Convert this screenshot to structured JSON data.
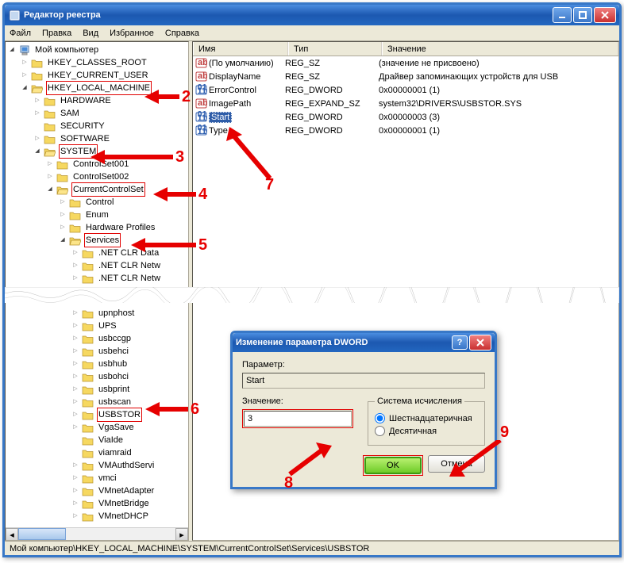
{
  "window": {
    "title": "Редактор реестра"
  },
  "menu": [
    "Файл",
    "Правка",
    "Вид",
    "Избранное",
    "Справка"
  ],
  "tree_top": [
    {
      "depth": 0,
      "exp": "open",
      "icon": "computer",
      "label": "Мой компьютер",
      "red": false
    },
    {
      "depth": 1,
      "exp": "closed",
      "icon": "folder",
      "label": "HKEY_CLASSES_ROOT",
      "red": false
    },
    {
      "depth": 1,
      "exp": "closed",
      "icon": "folder",
      "label": "HKEY_CURRENT_USER",
      "red": false
    },
    {
      "depth": 1,
      "exp": "open",
      "icon": "folder-open",
      "label": "HKEY_LOCAL_MACHINE",
      "red": true
    },
    {
      "depth": 2,
      "exp": "closed",
      "icon": "folder",
      "label": "HARDWARE",
      "red": false
    },
    {
      "depth": 2,
      "exp": "closed",
      "icon": "folder",
      "label": "SAM",
      "red": false
    },
    {
      "depth": 2,
      "exp": "none",
      "icon": "folder",
      "label": "SECURITY",
      "red": false
    },
    {
      "depth": 2,
      "exp": "closed",
      "icon": "folder",
      "label": "SOFTWARE",
      "red": false
    },
    {
      "depth": 2,
      "exp": "open",
      "icon": "folder-open",
      "label": "SYSTEM",
      "red": true
    },
    {
      "depth": 3,
      "exp": "closed",
      "icon": "folder",
      "label": "ControlSet001",
      "red": false
    },
    {
      "depth": 3,
      "exp": "closed",
      "icon": "folder",
      "label": "ControlSet002",
      "red": false
    },
    {
      "depth": 3,
      "exp": "open",
      "icon": "folder-open",
      "label": "CurrentControlSet",
      "red": true
    },
    {
      "depth": 4,
      "exp": "closed",
      "icon": "folder",
      "label": "Control",
      "red": false
    },
    {
      "depth": 4,
      "exp": "closed",
      "icon": "folder",
      "label": "Enum",
      "red": false
    },
    {
      "depth": 4,
      "exp": "closed",
      "icon": "folder",
      "label": "Hardware Profiles",
      "red": false
    },
    {
      "depth": 4,
      "exp": "open",
      "icon": "folder-open",
      "label": "Services",
      "red": true
    },
    {
      "depth": 5,
      "exp": "closed",
      "icon": "folder",
      "label": ".NET CLR Data",
      "red": false
    },
    {
      "depth": 5,
      "exp": "closed",
      "icon": "folder",
      "label": ".NET CLR Netw",
      "red": false
    },
    {
      "depth": 5,
      "exp": "closed",
      "icon": "folder",
      "label": ".NET CLR Netw",
      "red": false
    }
  ],
  "tree_bottom": [
    {
      "depth": 5,
      "exp": "closed",
      "icon": "folder",
      "label": "upnphost",
      "red": false
    },
    {
      "depth": 5,
      "exp": "closed",
      "icon": "folder",
      "label": "UPS",
      "red": false
    },
    {
      "depth": 5,
      "exp": "closed",
      "icon": "folder",
      "label": "usbccgp",
      "red": false
    },
    {
      "depth": 5,
      "exp": "closed",
      "icon": "folder",
      "label": "usbehci",
      "red": false
    },
    {
      "depth": 5,
      "exp": "closed",
      "icon": "folder",
      "label": "usbhub",
      "red": false
    },
    {
      "depth": 5,
      "exp": "closed",
      "icon": "folder",
      "label": "usbohci",
      "red": false
    },
    {
      "depth": 5,
      "exp": "closed",
      "icon": "folder",
      "label": "usbprint",
      "red": false
    },
    {
      "depth": 5,
      "exp": "closed",
      "icon": "folder",
      "label": "usbscan",
      "red": false
    },
    {
      "depth": 5,
      "exp": "closed",
      "icon": "folder",
      "label": "USBSTOR",
      "red": true
    },
    {
      "depth": 5,
      "exp": "closed",
      "icon": "folder",
      "label": "VgaSave",
      "red": false
    },
    {
      "depth": 5,
      "exp": "none",
      "icon": "folder",
      "label": "ViaIde",
      "red": false
    },
    {
      "depth": 5,
      "exp": "none",
      "icon": "folder",
      "label": "viamraid",
      "red": false
    },
    {
      "depth": 5,
      "exp": "closed",
      "icon": "folder",
      "label": "VMAuthdServi",
      "red": false
    },
    {
      "depth": 5,
      "exp": "closed",
      "icon": "folder",
      "label": "vmci",
      "red": false
    },
    {
      "depth": 5,
      "exp": "closed",
      "icon": "folder",
      "label": "VMnetAdapter",
      "red": false
    },
    {
      "depth": 5,
      "exp": "closed",
      "icon": "folder",
      "label": "VMnetBridge",
      "red": false
    },
    {
      "depth": 5,
      "exp": "closed",
      "icon": "folder",
      "label": "VMnetDHCP",
      "red": false
    }
  ],
  "columns": {
    "name": "Имя",
    "type": "Тип",
    "value": "Значение"
  },
  "values": [
    {
      "icon": "sz",
      "name": "(По умолчанию)",
      "type": "REG_SZ",
      "value": "(значение не присвоено)",
      "sel": false
    },
    {
      "icon": "sz",
      "name": "DisplayName",
      "type": "REG_SZ",
      "value": "Драйвер запоминающих устройств для USB",
      "sel": false
    },
    {
      "icon": "bin",
      "name": "ErrorControl",
      "type": "REG_DWORD",
      "value": "0x00000001 (1)",
      "sel": false
    },
    {
      "icon": "sz",
      "name": "ImagePath",
      "type": "REG_EXPAND_SZ",
      "value": "system32\\DRIVERS\\USBSTOR.SYS",
      "sel": false
    },
    {
      "icon": "bin",
      "name": "Start",
      "type": "REG_DWORD",
      "value": "0x00000003 (3)",
      "sel": true
    },
    {
      "icon": "bin",
      "name": "Type",
      "type": "REG_DWORD",
      "value": "0x00000001 (1)",
      "sel": false
    }
  ],
  "dialog": {
    "title": "Изменение параметра DWORD",
    "param_label": "Параметр:",
    "param_value": "Start",
    "value_label": "Значение:",
    "value_value": "3",
    "group_label": "Система исчисления",
    "radio_hex": "Шестнадцатеричная",
    "radio_dec": "Десятичная",
    "ok": "OK",
    "cancel": "Отмена"
  },
  "status": "Мой компьютер\\HKEY_LOCAL_MACHINE\\SYSTEM\\CurrentControlSet\\Services\\USBSTOR",
  "annotations": {
    "n2": "2",
    "n3": "3",
    "n4": "4",
    "n5": "5",
    "n6": "6",
    "n7": "7",
    "n8": "8",
    "n9": "9"
  }
}
